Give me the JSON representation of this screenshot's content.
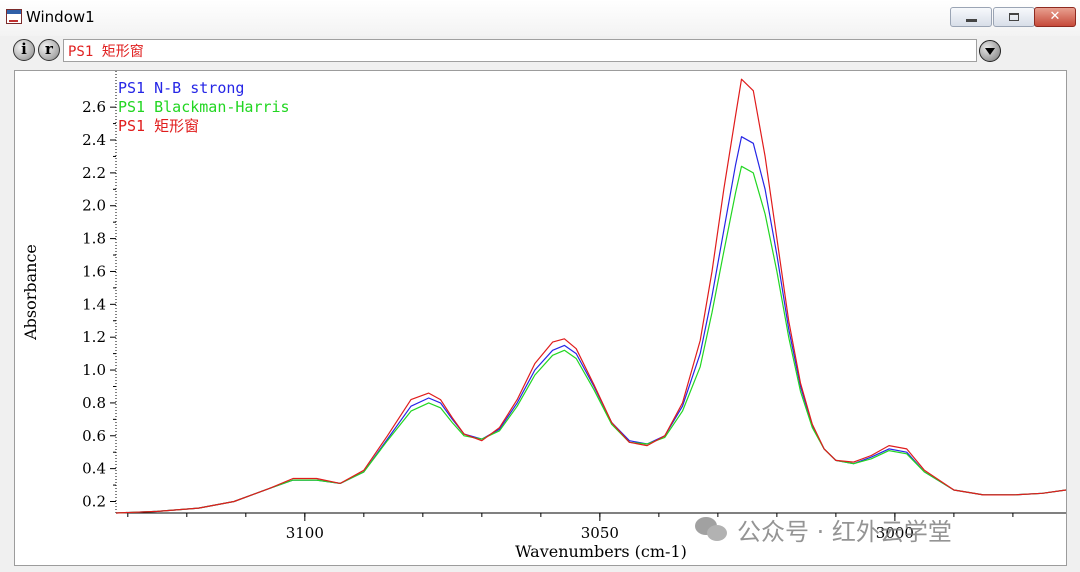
{
  "window": {
    "title": "Window1",
    "buttons": {
      "minimize": "–",
      "maximize": "□",
      "close": "✕"
    }
  },
  "toolbar": {
    "info_label": "i",
    "reset_label": "r",
    "spectrum_title": "PS1 矩形窗",
    "dropdown_icon": "chevron-down-icon"
  },
  "colors": {
    "blue": "#2626e6",
    "green": "#22d622",
    "red": "#e01c1c"
  },
  "watermark": {
    "text": "公众号 · 红外云学堂"
  },
  "chart_data": {
    "type": "line",
    "xlabel": "Wavenumbers (cm-1)",
    "ylabel": "Absorbance",
    "xlim": [
      3132,
      2971
    ],
    "ylim": [
      0.13,
      2.82
    ],
    "x_ticks": [
      3100,
      3050,
      3000
    ],
    "y_ticks": [
      0.2,
      0.4,
      0.6,
      0.8,
      1.0,
      1.2,
      1.4,
      1.6,
      1.8,
      2.0,
      2.2,
      2.4,
      2.6
    ],
    "legend_position": "top-left",
    "series": [
      {
        "name": "PS1 N-B strong",
        "color": "#2626e6",
        "x": [
          3132,
          3125,
          3118,
          3112,
          3106,
          3102,
          3098,
          3094,
          3090,
          3086,
          3082,
          3079,
          3077,
          3075,
          3073,
          3070,
          3067,
          3064,
          3061,
          3058,
          3056,
          3054,
          3051,
          3048,
          3045,
          3042,
          3039,
          3036,
          3033,
          3031,
          3029,
          3027,
          3026,
          3024,
          3022,
          3020,
          3018,
          3016,
          3014,
          3012,
          3010,
          3007,
          3004,
          3001,
          2998,
          2995,
          2990,
          2985,
          2980,
          2975,
          2971
        ],
        "y": [
          0.13,
          0.14,
          0.16,
          0.2,
          0.28,
          0.33,
          0.33,
          0.31,
          0.38,
          0.58,
          0.78,
          0.83,
          0.8,
          0.7,
          0.61,
          0.58,
          0.64,
          0.8,
          1.0,
          1.12,
          1.15,
          1.1,
          0.9,
          0.68,
          0.57,
          0.55,
          0.6,
          0.78,
          1.1,
          1.45,
          1.85,
          2.25,
          2.42,
          2.38,
          2.1,
          1.7,
          1.25,
          0.9,
          0.66,
          0.52,
          0.45,
          0.43,
          0.47,
          0.52,
          0.5,
          0.38,
          0.27,
          0.24,
          0.24,
          0.25,
          0.27
        ]
      },
      {
        "name": "PS1 Blackman-Harris",
        "color": "#22d622",
        "x": [
          3132,
          3125,
          3118,
          3112,
          3106,
          3102,
          3098,
          3094,
          3090,
          3086,
          3082,
          3079,
          3077,
          3075,
          3073,
          3070,
          3067,
          3064,
          3061,
          3058,
          3056,
          3054,
          3051,
          3048,
          3045,
          3042,
          3039,
          3036,
          3033,
          3031,
          3029,
          3027,
          3026,
          3024,
          3022,
          3020,
          3018,
          3016,
          3014,
          3012,
          3010,
          3007,
          3004,
          3001,
          2998,
          2995,
          2990,
          2985,
          2980,
          2975,
          2971
        ],
        "y": [
          0.13,
          0.14,
          0.16,
          0.2,
          0.28,
          0.33,
          0.33,
          0.31,
          0.38,
          0.57,
          0.75,
          0.8,
          0.77,
          0.68,
          0.6,
          0.58,
          0.63,
          0.78,
          0.97,
          1.09,
          1.12,
          1.07,
          0.88,
          0.67,
          0.56,
          0.55,
          0.59,
          0.75,
          1.02,
          1.35,
          1.72,
          2.08,
          2.24,
          2.2,
          1.95,
          1.6,
          1.2,
          0.87,
          0.65,
          0.52,
          0.45,
          0.43,
          0.46,
          0.51,
          0.49,
          0.38,
          0.27,
          0.24,
          0.24,
          0.25,
          0.27
        ]
      },
      {
        "name": "PS1 矩形窗",
        "color": "#e01c1c",
        "x": [
          3132,
          3125,
          3118,
          3112,
          3106,
          3102,
          3098,
          3094,
          3090,
          3086,
          3082,
          3079,
          3077,
          3075,
          3073,
          3070,
          3067,
          3064,
          3061,
          3058,
          3056,
          3054,
          3051,
          3048,
          3045,
          3042,
          3039,
          3036,
          3033,
          3031,
          3029,
          3027,
          3026,
          3024,
          3022,
          3020,
          3018,
          3016,
          3014,
          3012,
          3010,
          3007,
          3004,
          3001,
          2998,
          2995,
          2990,
          2985,
          2980,
          2975,
          2971
        ],
        "y": [
          0.13,
          0.14,
          0.16,
          0.2,
          0.28,
          0.34,
          0.34,
          0.31,
          0.39,
          0.6,
          0.82,
          0.86,
          0.82,
          0.71,
          0.61,
          0.57,
          0.65,
          0.82,
          1.04,
          1.17,
          1.19,
          1.13,
          0.91,
          0.68,
          0.56,
          0.54,
          0.6,
          0.8,
          1.18,
          1.6,
          2.1,
          2.55,
          2.77,
          2.7,
          2.3,
          1.8,
          1.3,
          0.92,
          0.67,
          0.52,
          0.45,
          0.44,
          0.48,
          0.54,
          0.52,
          0.39,
          0.27,
          0.24,
          0.24,
          0.25,
          0.27
        ]
      }
    ]
  }
}
